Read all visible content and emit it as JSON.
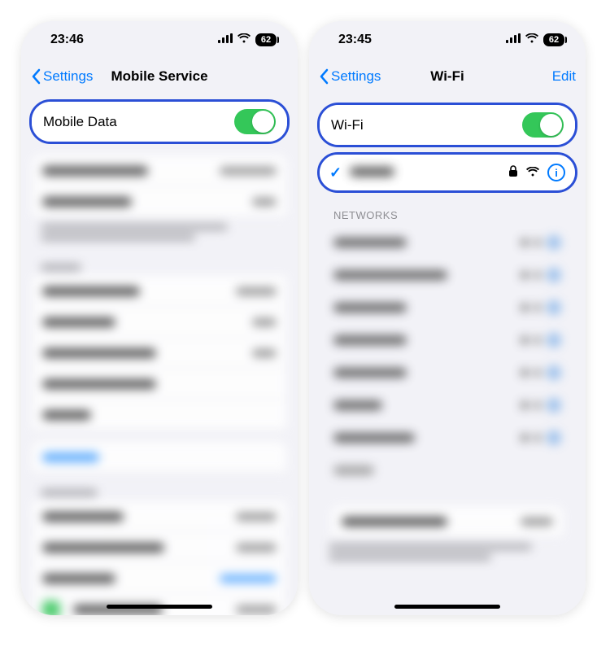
{
  "left": {
    "status_time": "23:46",
    "battery": "62",
    "back_label": "Settings",
    "title": "Mobile Service",
    "mobile_data_label": "Mobile Data"
  },
  "right": {
    "status_time": "23:45",
    "battery": "62",
    "back_label": "Settings",
    "title": "Wi-Fi",
    "edit_label": "Edit",
    "wifi_label": "Wi-Fi",
    "networks_header": "NETWORKS"
  }
}
